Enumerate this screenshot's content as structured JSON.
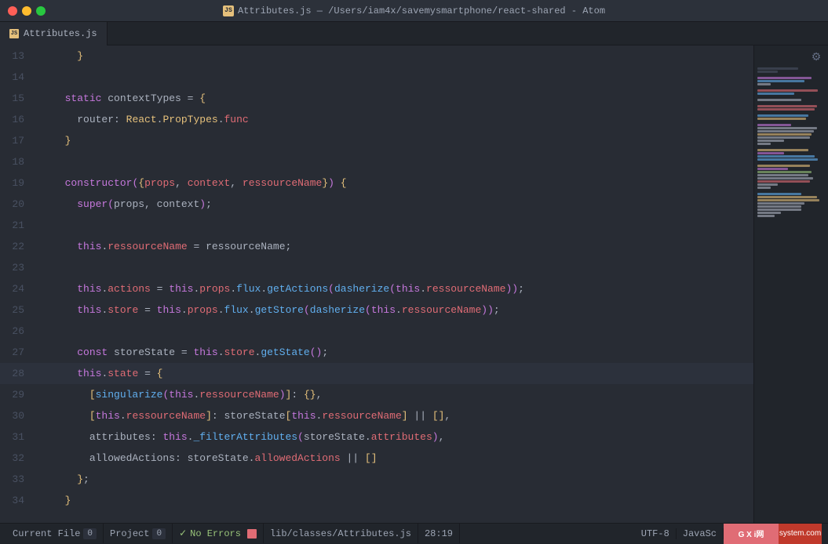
{
  "titlebar": {
    "title": "Attributes.js — /Users/iam4x/savemysmartphone/react-shared - Atom",
    "file_icon_label": "JS"
  },
  "tab": {
    "label": "Attributes.js",
    "icon_label": "JS"
  },
  "code": {
    "lines": [
      {
        "num": "13",
        "content": "    }"
      },
      {
        "num": "14",
        "content": ""
      },
      {
        "num": "15",
        "content": "  static contextTypes = {"
      },
      {
        "num": "16",
        "content": "    router: React.PropTypes.func"
      },
      {
        "num": "17",
        "content": "  }"
      },
      {
        "num": "18",
        "content": ""
      },
      {
        "num": "19",
        "content": "  constructor({props, context, ressourceName}) {"
      },
      {
        "num": "20",
        "content": "    super(props, context);"
      },
      {
        "num": "21",
        "content": ""
      },
      {
        "num": "22",
        "content": "    this.ressourceName = ressourceName;"
      },
      {
        "num": "23",
        "content": ""
      },
      {
        "num": "24",
        "content": "    this.actions = this.props.flux.getActions(dasherize(this.ressourceName));"
      },
      {
        "num": "25",
        "content": "    this.store = this.props.flux.getStore(dasherize(this.ressourceName));"
      },
      {
        "num": "26",
        "content": ""
      },
      {
        "num": "27",
        "content": "    const storeState = this.store.getState();"
      },
      {
        "num": "28",
        "content": "    this.state = {",
        "active": true
      },
      {
        "num": "29",
        "content": "      [singularize(this.ressourceName)]: {},"
      },
      {
        "num": "30",
        "content": "      [this.ressourceName]: storeState[this.ressourceName] || [],"
      },
      {
        "num": "31",
        "content": "      attributes: this._filterAttributes(storeState.attributes),"
      },
      {
        "num": "32",
        "content": "      allowedActions: storeState.allowedActions || []"
      },
      {
        "num": "33",
        "content": "    };"
      },
      {
        "num": "34",
        "content": "  }"
      }
    ]
  },
  "statusbar": {
    "current_file_label": "Current File",
    "current_file_badge": "0",
    "project_label": "Project",
    "project_badge": "0",
    "no_errors_label": "No Errors",
    "file_path": "lib/classes/Attributes.js",
    "cursor_pos": "28:19",
    "encoding": "UTF-8",
    "language": "JavaSc"
  },
  "minimap": {
    "gear_icon": "⚙"
  }
}
